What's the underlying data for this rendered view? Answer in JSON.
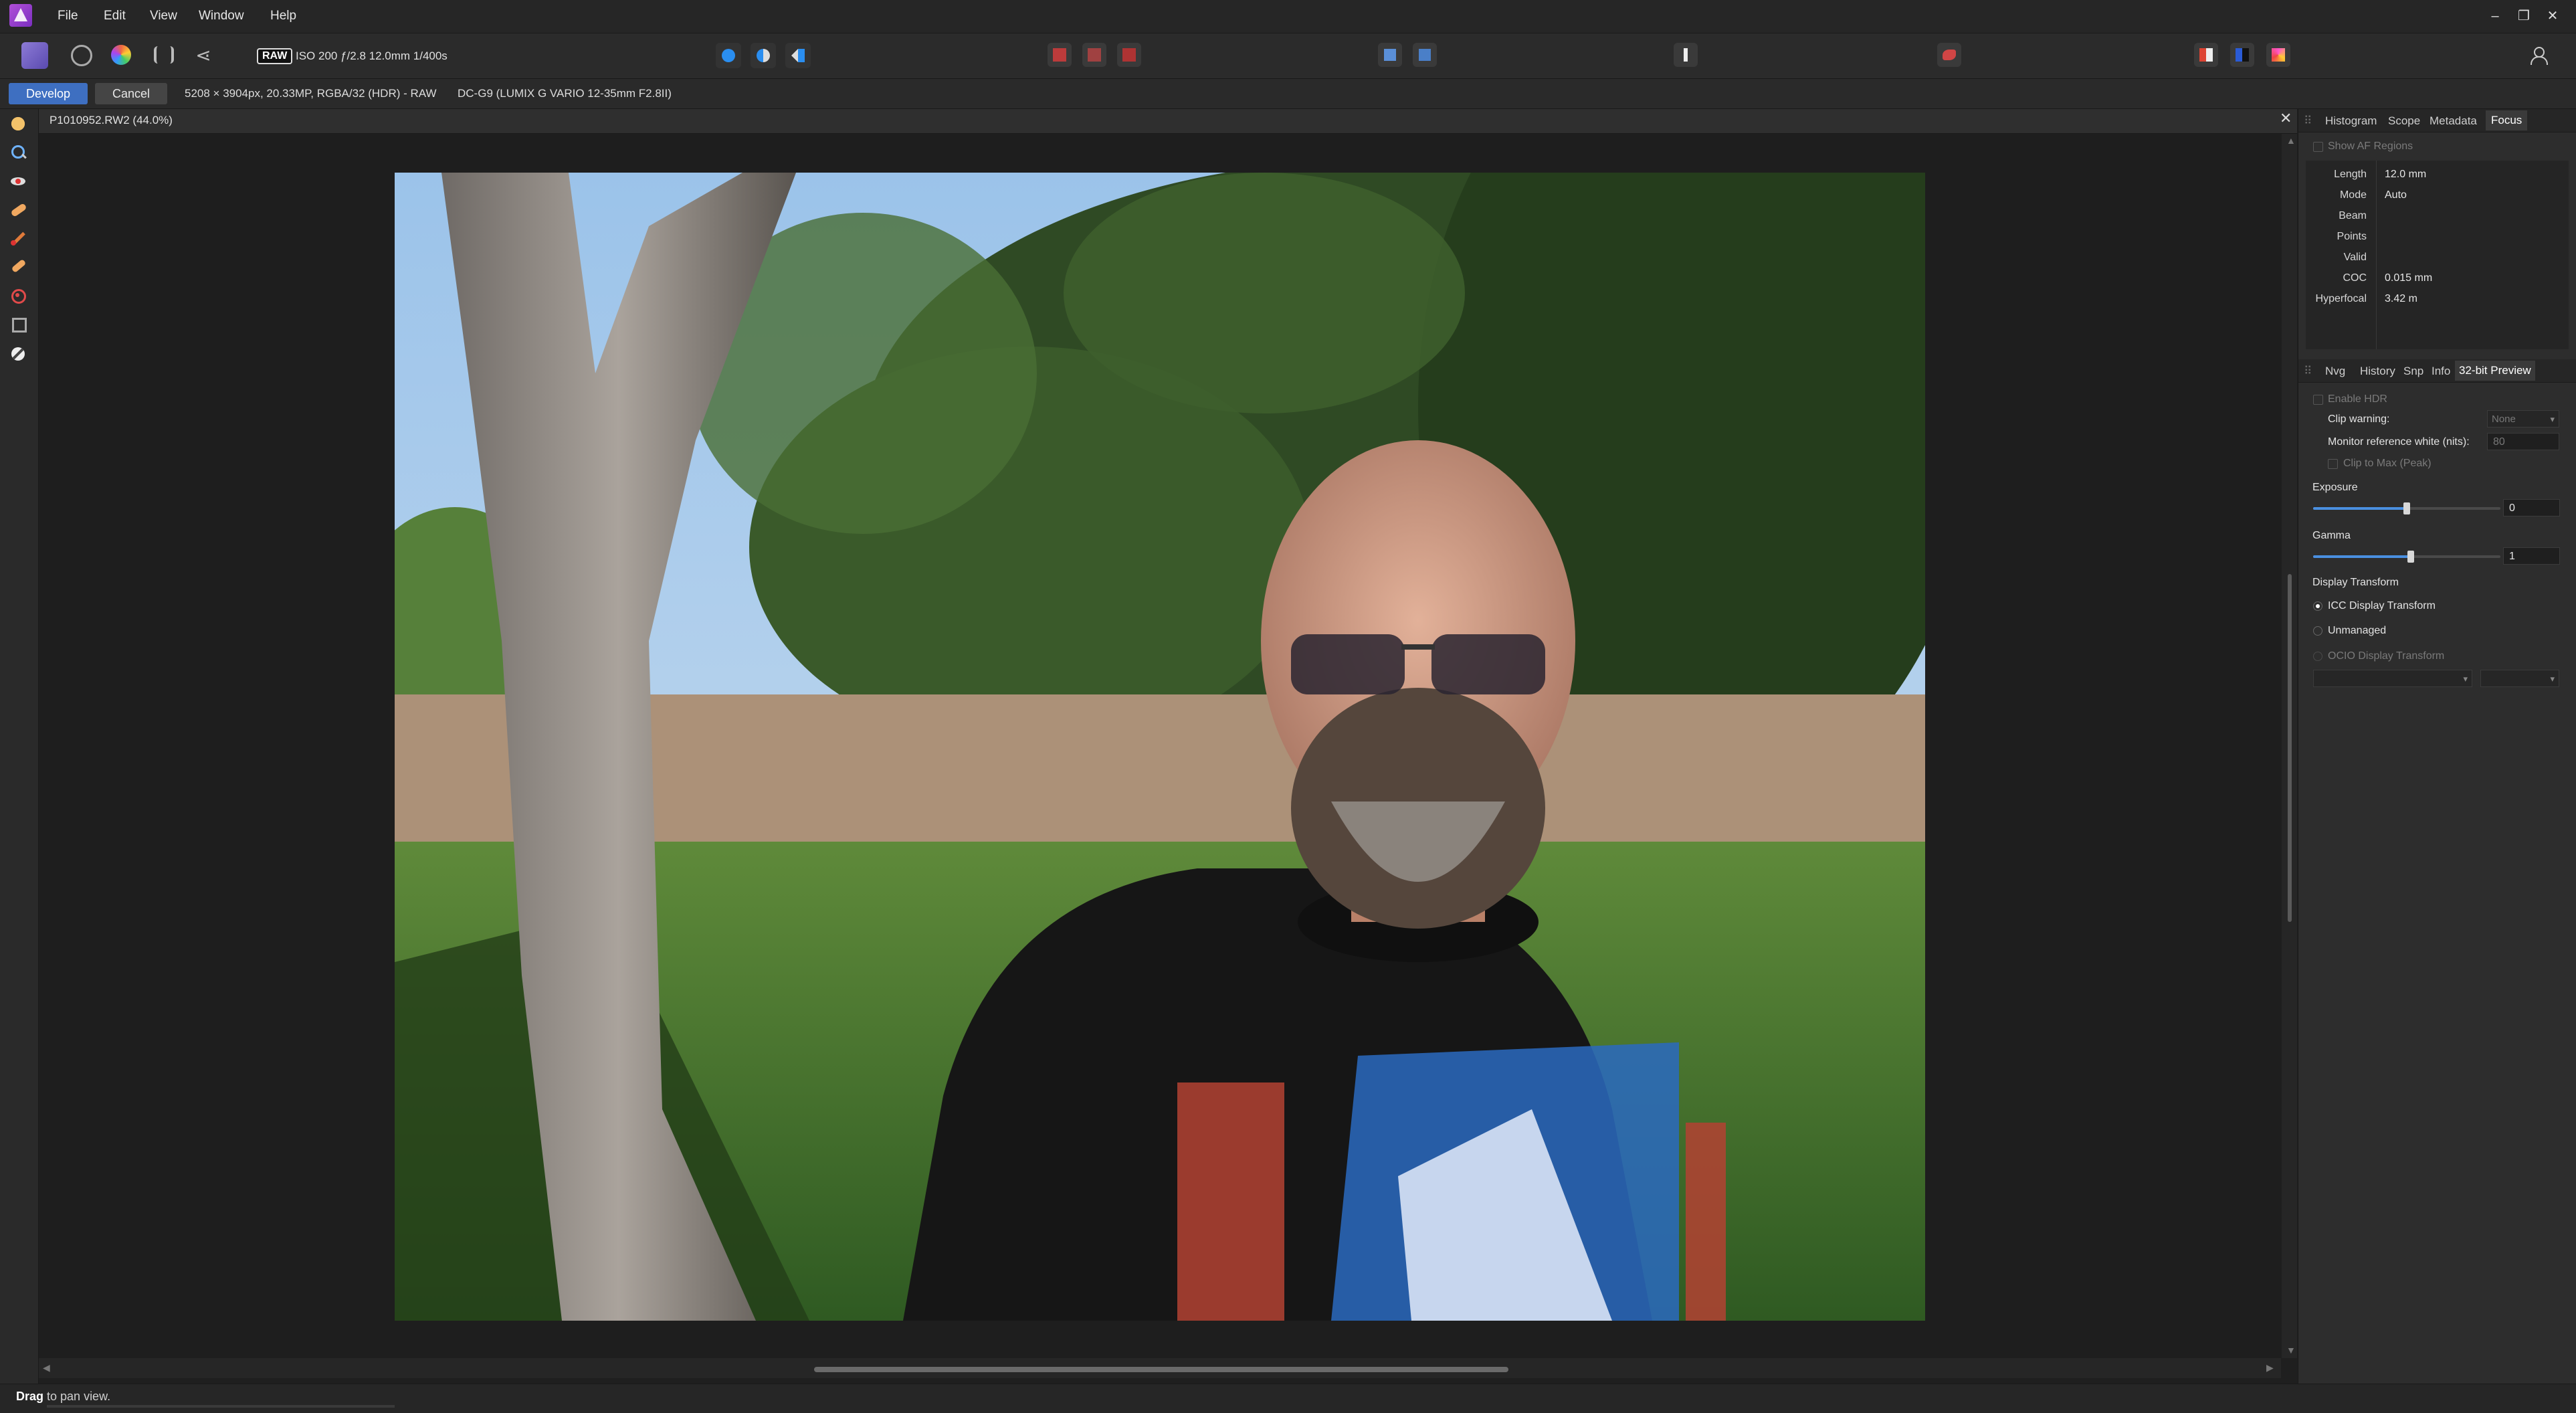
{
  "menu": {
    "items": [
      "File",
      "Edit",
      "View",
      "Window",
      "Help"
    ]
  },
  "window_controls": {
    "minimize": "–",
    "restore": "❐",
    "close": "✕"
  },
  "toolbar": {
    "raw_badge": "RAW",
    "exif": "ISO 200 ƒ/2.8 12.0mm 1/400s"
  },
  "context_bar": {
    "develop_label": "Develop",
    "cancel_label": "Cancel",
    "image_info": "5208 × 3904px, 20.33MP, RGBA/32 (HDR) - RAW",
    "lens_info": "DC-G9 (LUMIX G VARIO 12-35mm F2.8II)"
  },
  "document": {
    "title": "P1010952.RW2 (44.0%)",
    "close": "✕"
  },
  "top_panel": {
    "tabs": [
      "Histogram",
      "Scope",
      "Metadata",
      "Focus"
    ],
    "active_tab": "Focus",
    "show_af_regions": "Show AF Regions",
    "focus": [
      {
        "label": "Length",
        "value": "12.0 mm"
      },
      {
        "label": "Mode",
        "value": "Auto"
      },
      {
        "label": "Beam",
        "value": ""
      },
      {
        "label": "Points",
        "value": ""
      },
      {
        "label": "Valid",
        "value": ""
      },
      {
        "label": "COC",
        "value": "0.015 mm"
      },
      {
        "label": "Hyperfocal",
        "value": "3.42 m"
      }
    ]
  },
  "bottom_panel": {
    "tabs": [
      "Nvg",
      "History",
      "Snp",
      "Info",
      "32-bit Preview"
    ],
    "active_tab": "32-bit Preview",
    "enable_hdr": "Enable HDR",
    "clip_warning_label": "Clip warning:",
    "clip_warning_value": "None",
    "monitor_white_label": "Monitor reference white (nits):",
    "monitor_white_value": "80",
    "clip_to_max": "Clip to Max (Peak)",
    "exposure_label": "Exposure",
    "exposure_value": "0",
    "exposure_level": 0.5,
    "gamma_label": "Gamma",
    "gamma_value": "1",
    "gamma_level": 0.52,
    "display_transform_label": "Display Transform",
    "icc_label": "ICC Display Transform",
    "unmanaged_label": "Unmanaged",
    "ocio_label": "OCIO Display Transform"
  },
  "status_bar": {
    "bold": "Drag",
    "rest": " to pan view."
  },
  "icons": {
    "left_tools": [
      "hand-icon",
      "zoom-icon",
      "red-eye-icon",
      "blemish-icon",
      "brush-icon",
      "overlay-brush-icon",
      "target-icon",
      "crop-icon",
      "white-balance-icon"
    ]
  },
  "colors": {
    "accent": "#3e6fc1",
    "panel": "#2d2d2d",
    "canvas": "#1e1e1e"
  }
}
